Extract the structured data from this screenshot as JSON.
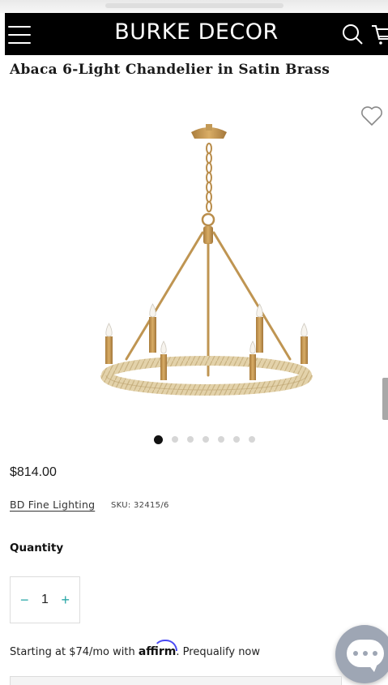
{
  "header": {
    "brand": "BURKE DECOR",
    "background": "#000000",
    "menu_icon": "hamburger-menu-icon",
    "search_icon": "search-icon",
    "cart_icon": "cart-icon"
  },
  "product": {
    "title": "Abaca 6-Light Chandelier in Satin Brass",
    "price": "$814.00",
    "vendor": "BD Fine Lighting",
    "sku": "SKU: 32415/6",
    "image": "chandelier-image",
    "wishlist_icon": "heart-icon"
  },
  "gallery": {
    "dot_count": 7,
    "active_index": 0
  },
  "quantity": {
    "label": "Quantity",
    "value": "1",
    "minus": "−",
    "plus": "+"
  },
  "financing": {
    "prefix": "Starting at $74/mo with ",
    "brand": "affirm",
    "suffix": ". Prequalify now"
  },
  "colors": {
    "accent": "#2aa7a7",
    "affirm_arc": "#4a4af4",
    "chat_bubble": "#9ea6b4"
  },
  "chat": {
    "icon": "chat-bubble-icon"
  }
}
